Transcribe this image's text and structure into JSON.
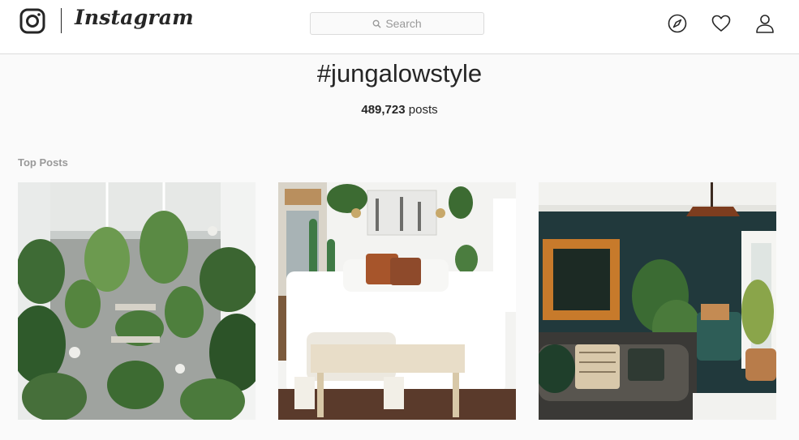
{
  "header": {
    "logo_text": "Instagram",
    "search_placeholder": "Search",
    "icons": [
      "instagram-glyph-icon",
      "search-icon",
      "compass-icon",
      "heart-icon",
      "user-icon"
    ]
  },
  "hashtag": {
    "title": "#jungalowstyle",
    "post_count": "489,723",
    "post_label": "posts"
  },
  "section": {
    "label": "Top Posts"
  },
  "posts": [
    {
      "kind": "greenhouse-plants-photo"
    },
    {
      "kind": "white-bedroom-photo"
    },
    {
      "kind": "teal-living-room-photo"
    }
  ],
  "colors": {
    "background": "#fafafa",
    "border": "#dbdbdb",
    "text": "#262626",
    "muted": "#999999"
  }
}
